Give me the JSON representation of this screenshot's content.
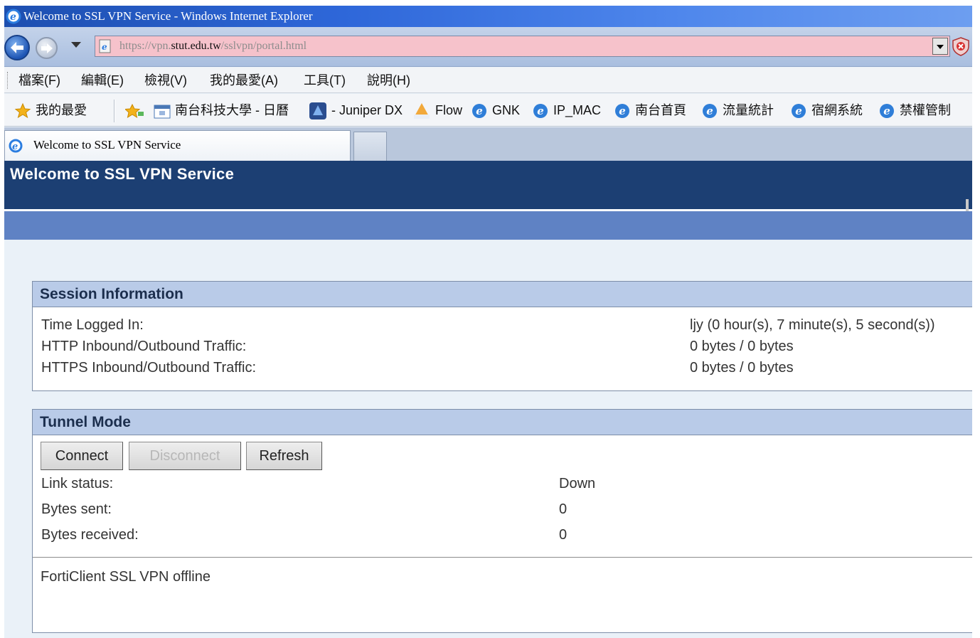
{
  "window": {
    "title": "Welcome to SSL VPN Service - Windows Internet Explorer"
  },
  "address_bar": {
    "url_prefix": "https://vpn.",
    "url_domain": "stut.edu.tw",
    "url_path": "/sslvpn/portal.html"
  },
  "menu": {
    "items": [
      "檔案(F)",
      "編輯(E)",
      "檢視(V)",
      "我的最愛(A)",
      "工具(T)",
      "說明(H)"
    ]
  },
  "favorites": {
    "label": "我的最愛",
    "links": [
      "南台科技大學 - 日曆",
      "- Juniper DX",
      "Flow",
      "GNK",
      "IP_MAC",
      "南台首頁",
      "流量統計",
      "宿網系統",
      "禁權管制"
    ]
  },
  "tab": {
    "label": "Welcome to SSL VPN Service"
  },
  "page": {
    "title": "Welcome to SSL VPN Service"
  },
  "session": {
    "heading": "Session Information",
    "rows": [
      {
        "label": "Time Logged In:",
        "value": "ljy (0 hour(s), 7 minute(s), 5 second(s))"
      },
      {
        "label": "HTTP Inbound/Outbound Traffic:",
        "value": "0 bytes / 0 bytes"
      },
      {
        "label": "HTTPS Inbound/Outbound Traffic:",
        "value": "0 bytes / 0 bytes"
      }
    ]
  },
  "tunnel": {
    "heading": "Tunnel Mode",
    "buttons": {
      "connect": "Connect",
      "disconnect": "Disconnect",
      "refresh": "Refresh"
    },
    "rows": [
      {
        "label": "Link status:",
        "value": "Down"
      },
      {
        "label": "Bytes sent:",
        "value": "0"
      },
      {
        "label": "Bytes received:",
        "value": "0"
      }
    ],
    "status_message": "FortiClient SSL VPN offline"
  }
}
